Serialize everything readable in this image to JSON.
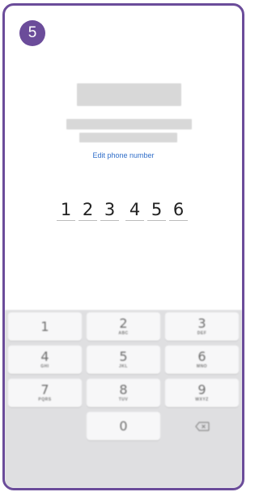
{
  "step": {
    "number": "5"
  },
  "edit_link": "Edit phone number",
  "code_digits": [
    "1",
    "2",
    "3",
    "4",
    "5",
    "6"
  ],
  "keypad": {
    "keys": [
      {
        "num": "1",
        "letters": ""
      },
      {
        "num": "2",
        "letters": "ABC"
      },
      {
        "num": "3",
        "letters": "DEF"
      },
      {
        "num": "4",
        "letters": "GHI"
      },
      {
        "num": "5",
        "letters": "JKL"
      },
      {
        "num": "6",
        "letters": "MNO"
      },
      {
        "num": "7",
        "letters": "PQRS"
      },
      {
        "num": "8",
        "letters": "TUV"
      },
      {
        "num": "9",
        "letters": "WXYZ"
      },
      {
        "num": "0",
        "letters": ""
      }
    ],
    "backspace_icon": "backspace-icon"
  },
  "colors": {
    "accent": "#6b4c9a",
    "link": "#2f6ec9",
    "keypad_bg": "#dfdfe1"
  }
}
